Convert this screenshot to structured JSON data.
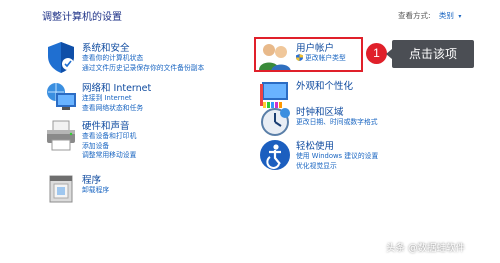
{
  "page": {
    "title": "调整计算机的设置"
  },
  "view_by": {
    "label": "查看方式:",
    "value": "类别",
    "chevron": "▾"
  },
  "categories_left": [
    {
      "name": "system-security",
      "icon": "shield-icon",
      "title": "系统和安全",
      "links": [
        "查看你的计算机状态",
        "通过文件历史记录保存你的文件备份副本"
      ]
    },
    {
      "name": "network-internet",
      "icon": "network-globe-icon",
      "title": "网络和 Internet",
      "links": [
        "连接到 Internet",
        "查看网络状态和任务"
      ]
    },
    {
      "name": "hardware-sound",
      "icon": "printer-icon",
      "title": "硬件和声音",
      "links": [
        "查看设备和打印机",
        "添加设备",
        "调整常用移动设置"
      ]
    },
    {
      "name": "programs",
      "icon": "programs-icon",
      "title": "程序",
      "links": [
        "卸载程序"
      ]
    }
  ],
  "categories_right": [
    {
      "name": "user-accounts",
      "icon": "users-icon",
      "title": "用户帐户",
      "links": [
        "更改帐户类型"
      ]
    },
    {
      "name": "appearance",
      "icon": "monitor-icon",
      "title": "外观和个性化",
      "links": []
    },
    {
      "name": "clock-region",
      "icon": "clock-icon",
      "title": "时钟和区域",
      "links": [
        "更改日期、时间或数字格式"
      ]
    },
    {
      "name": "ease-of-access",
      "icon": "accessibility-icon",
      "title": "轻松使用",
      "links": [
        "使用 Windows 建议的设置",
        "优化视觉显示"
      ]
    }
  ],
  "annotation": {
    "step_number": "1",
    "callout_text": "点击该项"
  },
  "watermark": {
    "text": "头条 @数据蛙软件"
  },
  "colors": {
    "link": "#1a66c2",
    "title": "#0e4a9f",
    "highlight": "#e0202a",
    "callout": "#4b4e54"
  }
}
